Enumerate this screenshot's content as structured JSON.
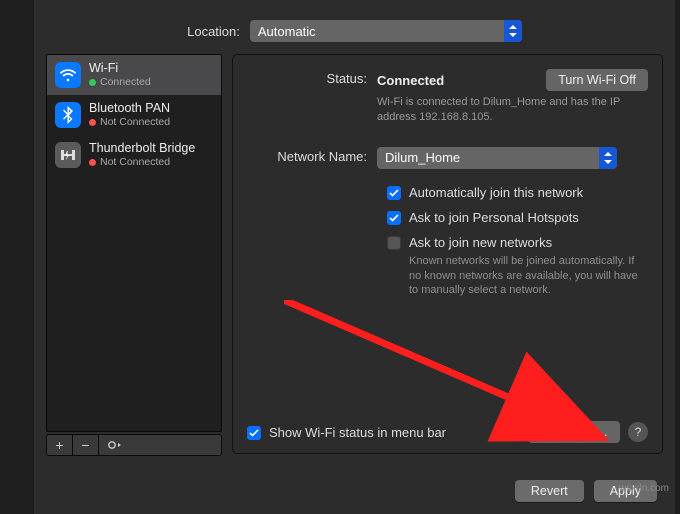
{
  "location": {
    "label": "Location:",
    "value": "Automatic"
  },
  "sidebar": {
    "items": [
      {
        "name": "Wi-Fi",
        "status": "Connected",
        "state": "green",
        "icon": "wifi"
      },
      {
        "name": "Bluetooth PAN",
        "status": "Not Connected",
        "state": "red",
        "icon": "bt"
      },
      {
        "name": "Thunderbolt Bridge",
        "status": "Not Connected",
        "state": "red",
        "icon": "tb"
      }
    ]
  },
  "panel": {
    "status_label": "Status:",
    "status_value": "Connected",
    "turn_off_label": "Turn Wi-Fi Off",
    "status_desc": "Wi-Fi is connected to Dilum_Home and has the IP address 192.168.8.105.",
    "network_name_label": "Network Name:",
    "network_name_value": "Dilum_Home",
    "auto_join_label": "Automatically join this network",
    "ask_personal_label": "Ask to join Personal Hotspots",
    "ask_new_label": "Ask to join new networks",
    "ask_new_desc": "Known networks will be joined automatically. If no known networks are available, you will have to manually select a network.",
    "show_menu_bar_label": "Show Wi-Fi status in menu bar",
    "advanced_label": "Advanced…",
    "help_label": "?"
  },
  "buttons": {
    "revert": "Revert",
    "apply": "Apply"
  },
  "watermark": "wsxdn.com"
}
